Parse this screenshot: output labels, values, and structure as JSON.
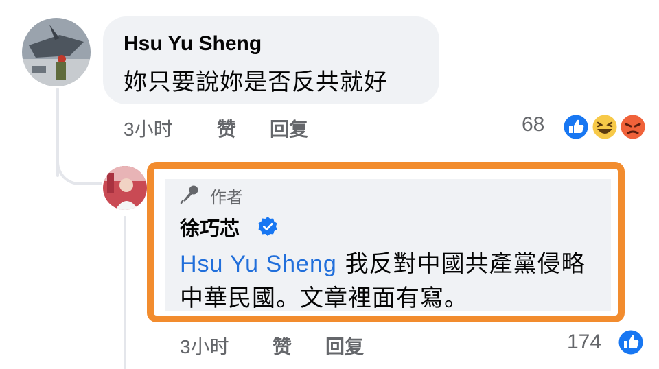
{
  "comment": {
    "author": "Hsu Yu Sheng",
    "text": "妳只要說妳是否反共就好",
    "time": "3小时",
    "like_label": "赞",
    "reply_label": "回复",
    "reaction_count": "68",
    "reactions": [
      "like-icon",
      "haha-icon",
      "angry-icon"
    ]
  },
  "reply": {
    "badge_label": "作者",
    "author": "徐巧芯",
    "mention": "Hsu Yu Sheng",
    "text": " 我反對中國共產黨侵略中華民國。文章裡面有寫。",
    "time": "3小时",
    "like_label": "赞",
    "reply_label": "回复",
    "reaction_count": "174",
    "reactions": [
      "like-icon"
    ]
  },
  "colors": {
    "highlight_frame": "#f28c2e",
    "bubble": "#f0f2f5",
    "mention": "#216fdb",
    "like_blue": "#1877f2",
    "meta_gray": "#65676b"
  }
}
